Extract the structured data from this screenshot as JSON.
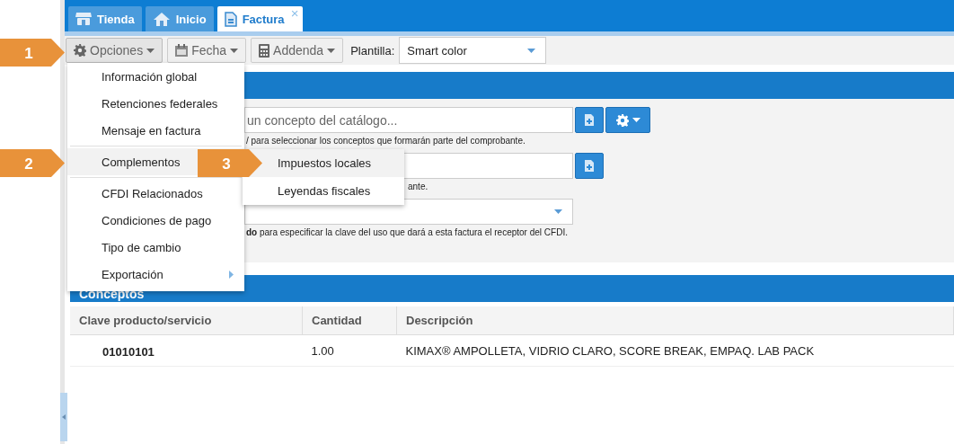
{
  "tabs": [
    {
      "label": "Tienda",
      "selected": false
    },
    {
      "label": "Inicio",
      "selected": false
    },
    {
      "label": "Factura",
      "selected": true,
      "close": "×"
    }
  ],
  "toolbar": {
    "buttons": [
      {
        "label": "Opciones",
        "pressed": true
      },
      {
        "label": "Fecha",
        "pressed": false
      },
      {
        "label": "Addenda",
        "pressed": false
      }
    ],
    "template_label": "Plantilla:",
    "template_value": "Smart color"
  },
  "options_menu": {
    "items": [
      {
        "kind": "item",
        "label": "Información global",
        "highlighted": false
      },
      {
        "kind": "item",
        "label": "Retenciones federales",
        "highlighted": false
      },
      {
        "kind": "item",
        "label": "Mensaje en factura",
        "highlighted": false
      },
      {
        "kind": "divider"
      },
      {
        "kind": "item",
        "label": "Complementos",
        "highlighted": true
      },
      {
        "kind": "divider"
      },
      {
        "kind": "item",
        "label": "CFDI Relacionados",
        "highlighted": false
      },
      {
        "kind": "item",
        "label": "Condiciones de pago",
        "highlighted": false
      },
      {
        "kind": "item",
        "label": "Tipo de cambio",
        "highlighted": false
      },
      {
        "kind": "submenu",
        "label": "Exportación",
        "highlighted": false
      }
    ]
  },
  "submenu": {
    "items": [
      {
        "label": "Impuestos locales",
        "highlighted": true
      },
      {
        "label": "Leyendas fiscales",
        "highlighted": false
      }
    ]
  },
  "callouts": [
    "1",
    "2",
    "3"
  ],
  "form": {
    "fields": [
      {
        "kind": "search",
        "placeholder": "un concepto del catálogo...",
        "hint": "/ para seleccionar los conceptos que formarán parte del comprobante."
      },
      {
        "kind": "text",
        "hint": "ante."
      },
      {
        "kind": "select",
        "hint": "**do** para especificar la clave del uso que dará a esta factura el receptor del CFDI."
      }
    ]
  },
  "concepts": {
    "title": "Conceptos",
    "columns": [
      "Clave producto/servicio",
      "Cantidad",
      "Descripción"
    ],
    "rows": [
      [
        "01010101",
        "1.00",
        "KIMAX® AMPOLLETA, VIDRIO CLARO, SCORE BREAK, EMPAQ. LAB PACK"
      ]
    ]
  }
}
